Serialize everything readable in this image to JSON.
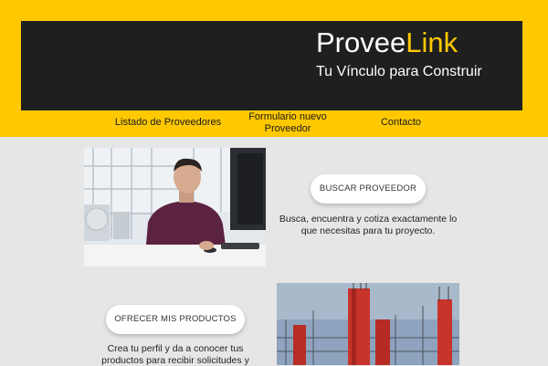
{
  "header": {
    "logo_primary": "Provee",
    "logo_accent": "Link",
    "tagline": "Tu Vínculo para Construir"
  },
  "nav": {
    "items": [
      {
        "label": "Listado de Proveedores"
      },
      {
        "label": "Formulario nuevo Proveedor"
      },
      {
        "label": "Contacto"
      }
    ]
  },
  "sections": {
    "buscar": {
      "button_label": "BUSCAR PROVEEDOR",
      "description": "Busca, encuentra y cotiza exactamente lo que necesitas para tu proyecto."
    },
    "ofrecer": {
      "button_label": "OFRECER MIS PRODUCTOS",
      "description": "Crea tu perfil y da a conocer tus productos para recibir solicitudes y"
    }
  },
  "colors": {
    "brand_yellow": "#ffc800",
    "banner_dark": "#1f1f1f",
    "page_bg": "#e6e6e6"
  }
}
